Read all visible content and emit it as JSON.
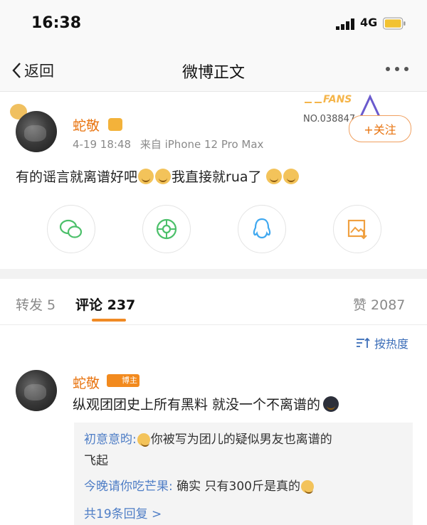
{
  "status_bar": {
    "time": "16:38",
    "network": "4G"
  },
  "nav": {
    "back_label": "返回",
    "title": "微博正文"
  },
  "post": {
    "author": "蛇敬",
    "date": "4-19 18:48",
    "source": "来自 iPhone 12 Pro Max",
    "follow_label": "+关注",
    "fans_label": "FANS",
    "fans_number": "NO.038847",
    "text_parts": [
      "有的谣言就离谱好吧",
      "我直接就rua了"
    ]
  },
  "share_icons": [
    "wechat-icon",
    "moments-icon",
    "qq-icon",
    "save-image-icon"
  ],
  "tabs": {
    "repost": "转发 5",
    "comments": "评论 237",
    "likes": "赞 2087"
  },
  "sort_label": "按热度",
  "comment": {
    "author": "蛇敬",
    "badge": "博主",
    "text": "纵观团团史上所有黑料 就没一个不离谱的",
    "replies": [
      {
        "user": "初意意昀:",
        "text_line1": "你被写为团儿的疑似男友也离谱的",
        "text_line2": "飞起"
      },
      {
        "user": "今晚请你吃芒果:",
        "text": "确实 只有300斤是真的"
      }
    ],
    "more_replies": "共19条回复 >"
  },
  "colors": {
    "accent": "#e8730e",
    "link": "#4f7ec6",
    "tab_underline": "#f08a24"
  }
}
